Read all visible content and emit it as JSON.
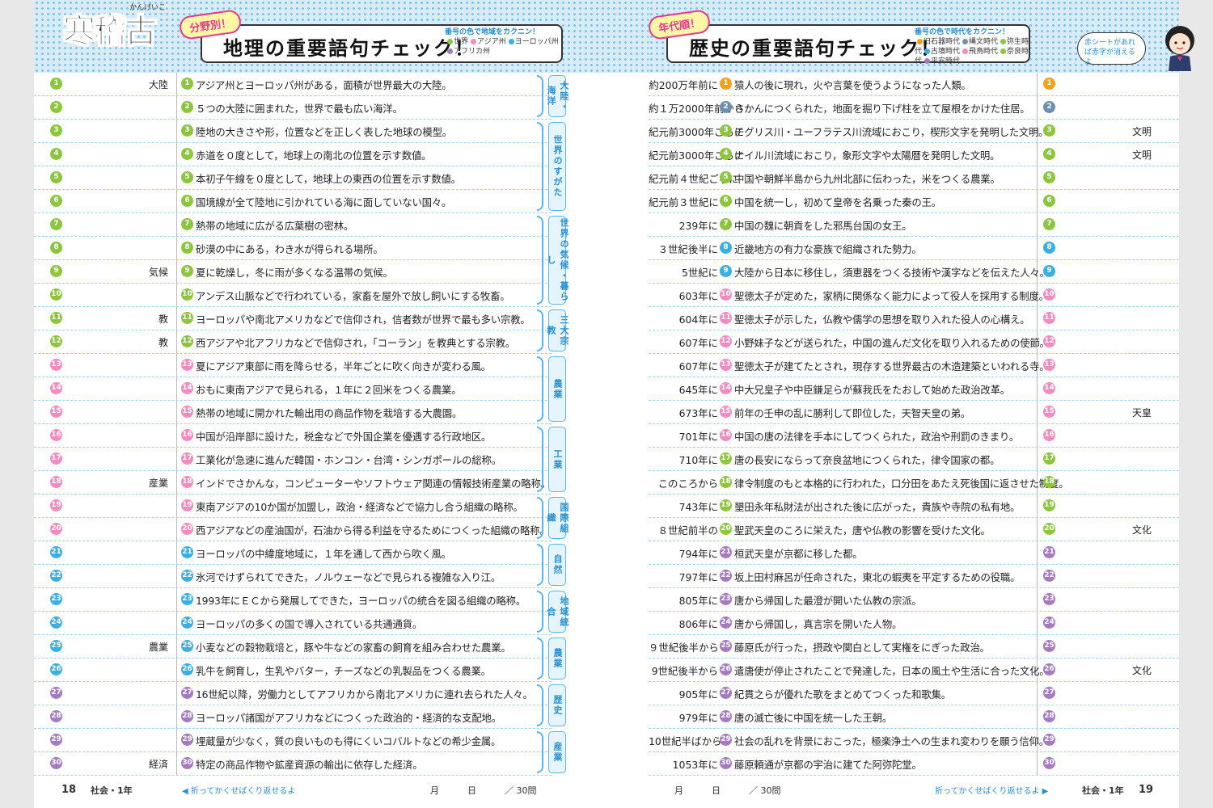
{
  "header": {
    "logo": "寒稽古",
    "logo_ruby": "かんげいこ",
    "left_tag": "分野別！",
    "left_title": "地理の重要語句チェック！",
    "left_legend_title": "番号の色で地域をカクニン！",
    "left_legend": [
      {
        "label": "世界",
        "color": "#8cc63f"
      },
      {
        "label": "アジア州",
        "color": "#f28cc0"
      },
      {
        "label": "ヨーロッパ州",
        "color": "#3ab0e2"
      },
      {
        "label": "アフリカ州",
        "color": "#a57ac1"
      }
    ],
    "right_tag": "年代順！",
    "right_title": "歴史の重要語句チェック！",
    "right_legend_title": "番号の色で時代をカクニン！",
    "right_legend": [
      {
        "label": "旧石器時代",
        "color": "#f6a01a"
      },
      {
        "label": "縄文時代",
        "color": "#6d8fb0"
      },
      {
        "label": "弥生時代",
        "color": "#8cc63f"
      },
      {
        "label": "古墳時代",
        "color": "#3ab0e2"
      },
      {
        "label": "飛鳥時代",
        "color": "#f28cc0"
      },
      {
        "label": "奈良時代",
        "color": "#8cc63f"
      },
      {
        "label": "平安時代",
        "color": "#a57ac1"
      }
    ],
    "bubble": "赤シートがあれば赤字が消えるよ"
  },
  "left_answers": [
    "大陸",
    "",
    "",
    "",
    "",
    "",
    "",
    "",
    "気候",
    "",
    "教",
    "教",
    "",
    "",
    "",
    "",
    "",
    "産業",
    "",
    "",
    "",
    "",
    "",
    "",
    "農業",
    "",
    "",
    "",
    "",
    "経済"
  ],
  "left_colors": [
    "#8cc63f",
    "#8cc63f",
    "#8cc63f",
    "#8cc63f",
    "#8cc63f",
    "#8cc63f",
    "#8cc63f",
    "#8cc63f",
    "#8cc63f",
    "#8cc63f",
    "#8cc63f",
    "#8cc63f",
    "#f28cc0",
    "#f28cc0",
    "#f28cc0",
    "#f28cc0",
    "#f28cc0",
    "#f28cc0",
    "#f28cc0",
    "#f28cc0",
    "#3ab0e2",
    "#3ab0e2",
    "#3ab0e2",
    "#3ab0e2",
    "#3ab0e2",
    "#3ab0e2",
    "#a57ac1",
    "#a57ac1",
    "#a57ac1",
    "#a57ac1"
  ],
  "left_questions": [
    "アジア州とヨーロッパ州がある，面積が世界最大の大陸。",
    "５つの大陸に囲まれた，世界で最も広い海洋。",
    "陸地の大きさや形，位置などを正しく表した地球の模型。",
    "赤道を０度として，地球上の南北の位置を示す数値。",
    "本初子午線を０度として，地球上の東西の位置を示す数値。",
    "国境線が全て陸地に引かれている海に面していない国々。",
    "熱帯の地域に広がる広葉樹の密林。",
    "砂漠の中にある，わき水が得られる場所。",
    "夏に乾燥し，冬に雨が多くなる温帯の気候。",
    "アンデス山脈などで行われている，家畜を屋外で放し飼いにする牧畜。",
    "ヨーロッパや南北アメリカなどで信仰され，信者数が世界で最も多い宗教。",
    "西アジアや北アフリカなどで信仰され，「コーラン」を教典とする宗教。",
    "夏にアジア東部に雨を降らせる，半年ごとに吹く向きが変わる風。",
    "おもに東南アジアで見られる，１年に２回米をつくる農業。",
    "熱帯の地域に開かれた輸出用の商品作物を栽培する大農園。",
    "中国が沿岸部に設けた，税金などで外国企業を優遇する行政地区。",
    "工業化が急速に進んだ韓国・ホンコン・台湾・シンガポールの総称。",
    "インドでさかんな，コンピューターやソフトウェア関連の情報技術産業の略称。",
    "東南アジアの10か国が加盟し，政治・経済などで協力し合う組織の略称。",
    "西アジアなどの産油国が，石油から得る利益を守るためにつくった組織の略称。",
    "ヨーロッパの中緯度地域に，１年を通して西から吹く風。",
    "氷河でけずられてできた，ノルウェーなどで見られる複雑な入り江。",
    "1993年にＥＣから発展してできた，ヨーロッパの統合を図る組織の略称。",
    "ヨーロッパの多くの国で導入されている共通通貨。",
    "小麦などの穀物栽培と，豚や牛などの家畜の飼育を組み合わせた農業。",
    "乳牛を飼育し，生乳やバター，チーズなどの乳製品をつくる農業。",
    "16世紀以降，労働力としてアフリカから南北アメリカに連れ去られた人々。",
    "ヨーロッパ諸国がアフリカなどにつくった政治的・経済的な支配地。",
    "埋蔵量が少なく，質の良いものも得にくいコバルトなどの希少金属。",
    "特定の商品作物や鉱産資源の輸出に依存した経済。"
  ],
  "left_categories": [
    {
      "label": "大陸・海洋",
      "from": 0,
      "to": 1
    },
    {
      "label": "世界のすがた",
      "from": 2,
      "to": 5
    },
    {
      "label": "世界の気候・暮らし",
      "from": 6,
      "to": 9
    },
    {
      "label": "三大宗教",
      "from": 10,
      "to": 11
    },
    {
      "label": "農業",
      "from": 12,
      "to": 14
    },
    {
      "label": "工業",
      "from": 15,
      "to": 17
    },
    {
      "label": "国際組織",
      "from": 18,
      "to": 19
    },
    {
      "label": "自然",
      "from": 20,
      "to": 21
    },
    {
      "label": "地域統合",
      "from": 22,
      "to": 23
    },
    {
      "label": "農業",
      "from": 24,
      "to": 25
    },
    {
      "label": "歴史",
      "from": 26,
      "to": 27
    },
    {
      "label": "産業",
      "from": 28,
      "to": 29
    }
  ],
  "right_when": [
    "約200万年前に",
    "約１万2000年前から",
    "紀元前3000年ごろに",
    "紀元前3000年ごろに",
    "紀元前４世紀ごろに",
    "紀元前３世紀に",
    "239年に",
    "３世紀後半に",
    "5世紀に",
    "603年に",
    "604年に",
    "607年に",
    "607年に",
    "645年に",
    "673年に",
    "701年に",
    "710年に",
    "このころから",
    "743年に",
    "８世紀前半の",
    "794年に",
    "797年に",
    "805年に",
    "806年に",
    "９世紀後半から",
    "9世紀後半から",
    "905年に",
    "979年に",
    "10世紀半ばから",
    "1053年に"
  ],
  "right_colors": [
    "#f6a01a",
    "#6d8fb0",
    "#8cc63f",
    "#8cc63f",
    "#8cc63f",
    "#8cc63f",
    "#8cc63f",
    "#3ab0e2",
    "#3ab0e2",
    "#f28cc0",
    "#f28cc0",
    "#f28cc0",
    "#f28cc0",
    "#f28cc0",
    "#f28cc0",
    "#f28cc0",
    "#8cc63f",
    "#8cc63f",
    "#8cc63f",
    "#8cc63f",
    "#a57ac1",
    "#a57ac1",
    "#a57ac1",
    "#a57ac1",
    "#a57ac1",
    "#a57ac1",
    "#a57ac1",
    "#a57ac1",
    "#a57ac1",
    "#a57ac1"
  ],
  "right_questions": [
    "猿人の後に現れ，火や言葉を使うようになった人類。",
    "さかんにつくられた，地面を掘り下げ柱を立て屋根をかけた住居。",
    "チグリス川・ユーフラテス川流域におこり，楔形文字を発明した文明。",
    "ナイル川流域におこり，象形文字や太陽暦を発明した文明。",
    "中国や朝鮮半島から九州北部に伝わった，米をつくる農業。",
    "中国を統一し，初めて皇帝を名乗った秦の王。",
    "中国の魏に朝貢をした邪馬台国の女王。",
    "近畿地方の有力な豪族で組織された勢力。",
    "大陸から日本に移住し，須恵器をつくる技術や漢字などを伝えた人々。",
    "聖徳太子が定めた，家柄に関係なく能力によって役人を採用する制度。",
    "聖徳太子が示した，仏教や儒学の思想を取り入れた役人の心構え。",
    "小野妹子などが送られた，中国の進んだ文化を取り入れるための使節。",
    "聖徳太子が建てたとされ，現存する世界最古の木造建築といわれる寺。",
    "中大兄皇子や中臣鎌足らが蘇我氏をたおして始めた政治改革。",
    "前年の壬申の乱に勝利して即位した，天智天皇の弟。",
    "中国の唐の法律を手本にしてつくられた，政治や刑罰のきまり。",
    "唐の長安にならって奈良盆地につくられた，律令国家の都。",
    "律令制度のもと本格的に行われた，口分田をあたえ死後国に返させた制度。",
    "墾田永年私財法が出された後に広がった，貴族や寺院の私有地。",
    "聖武天皇のころに栄えた，唐や仏教の影響を受けた文化。",
    "桓武天皇が京都に移した都。",
    "坂上田村麻呂が任命された，東北の蝦夷を平定するための役職。",
    "唐から帰国した最澄が開いた仏教の宗派。",
    "唐から帰国し，真言宗を開いた人物。",
    "藤原氏が行った，摂政や関白として実権をにぎった政治。",
    "遣唐使が停止されたことで発達した，日本の風土や生活に合った文化。",
    "紀貫之らが優れた歌をまとめてつくった和歌集。",
    "唐の滅亡後に中国を統一した王朝。",
    "社会の乱れを背景におこった，極楽浄土への生まれ変わりを願う信仰。",
    "藤原頼通が京都の宇治に建てた阿弥陀堂。"
  ],
  "right_answers": [
    "",
    "",
    "文明",
    "文明",
    "",
    "",
    "",
    "",
    "",
    "",
    "",
    "",
    "",
    "",
    "天皇",
    "",
    "",
    "",
    "",
    "文化",
    "",
    "",
    "",
    "",
    "",
    "文化",
    "",
    "",
    "",
    ""
  ],
  "footer": {
    "left_page": "18",
    "left_subject": "社会・1年",
    "fold_left": "◀ 折ってかくせばくり返せるよ",
    "month": "月",
    "day": "日",
    "total": "／ 30問",
    "fold_right": "折ってかくせばくり返せるよ ▶",
    "right_subject": "社会・1年",
    "right_page": "19"
  }
}
